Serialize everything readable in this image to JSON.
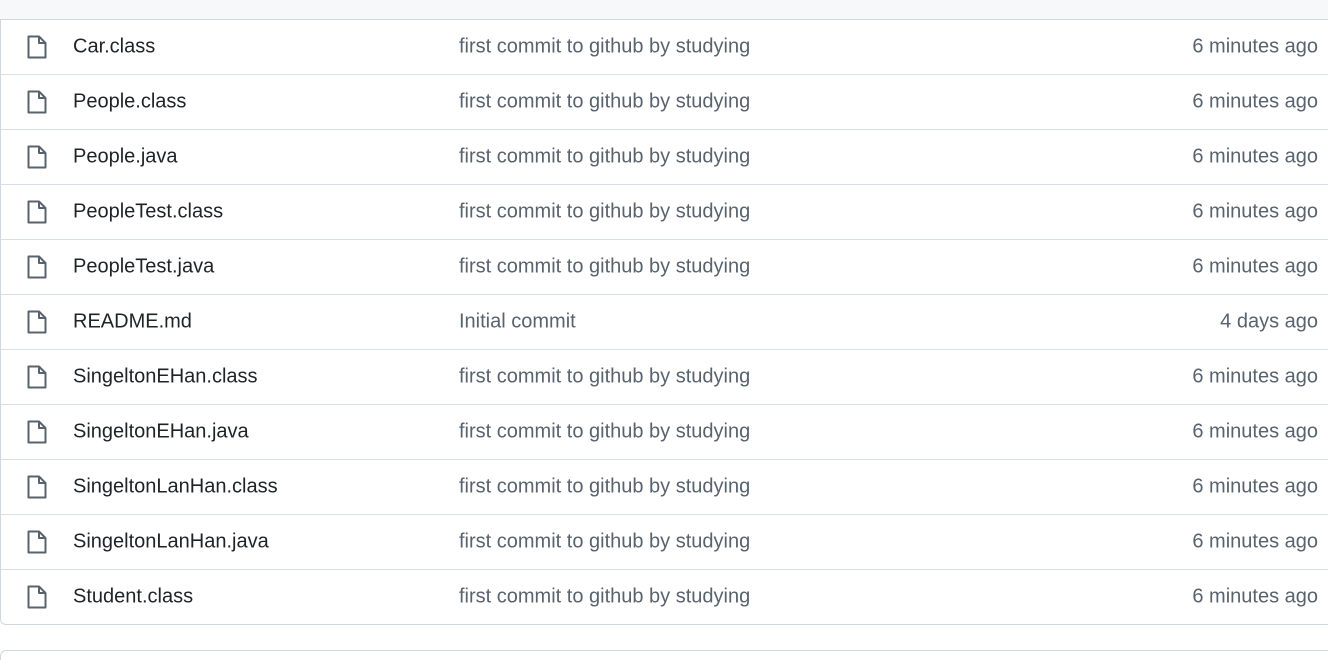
{
  "files": [
    {
      "name": "Car.class",
      "message": "first commit to github by studying",
      "age": "6 minutes ago",
      "icon": "file-icon"
    },
    {
      "name": "People.class",
      "message": "first commit to github by studying",
      "age": "6 minutes ago",
      "icon": "file-icon"
    },
    {
      "name": "People.java",
      "message": "first commit to github by studying",
      "age": "6 minutes ago",
      "icon": "file-icon"
    },
    {
      "name": "PeopleTest.class",
      "message": "first commit to github by studying",
      "age": "6 minutes ago",
      "icon": "file-icon"
    },
    {
      "name": "PeopleTest.java",
      "message": "first commit to github by studying",
      "age": "6 minutes ago",
      "icon": "file-icon"
    },
    {
      "name": "README.md",
      "message": "Initial commit",
      "age": "4 days ago",
      "icon": "file-icon"
    },
    {
      "name": "SingeltonEHan.class",
      "message": "first commit to github by studying",
      "age": "6 minutes ago",
      "icon": "file-icon"
    },
    {
      "name": "SingeltonEHan.java",
      "message": "first commit to github by studying",
      "age": "6 minutes ago",
      "icon": "file-icon"
    },
    {
      "name": "SingeltonLanHan.class",
      "message": "first commit to github by studying",
      "age": "6 minutes ago",
      "icon": "file-icon"
    },
    {
      "name": "SingeltonLanHan.java",
      "message": "first commit to github by studying",
      "age": "6 minutes ago",
      "icon": "file-icon"
    },
    {
      "name": "Student.class",
      "message": "first commit to github by studying",
      "age": "6 minutes ago",
      "icon": "file-icon"
    }
  ],
  "colors": {
    "name_text": "#1f2328",
    "muted_text": "#59636e",
    "border": "#d0d7de",
    "icon": "#59636e"
  }
}
